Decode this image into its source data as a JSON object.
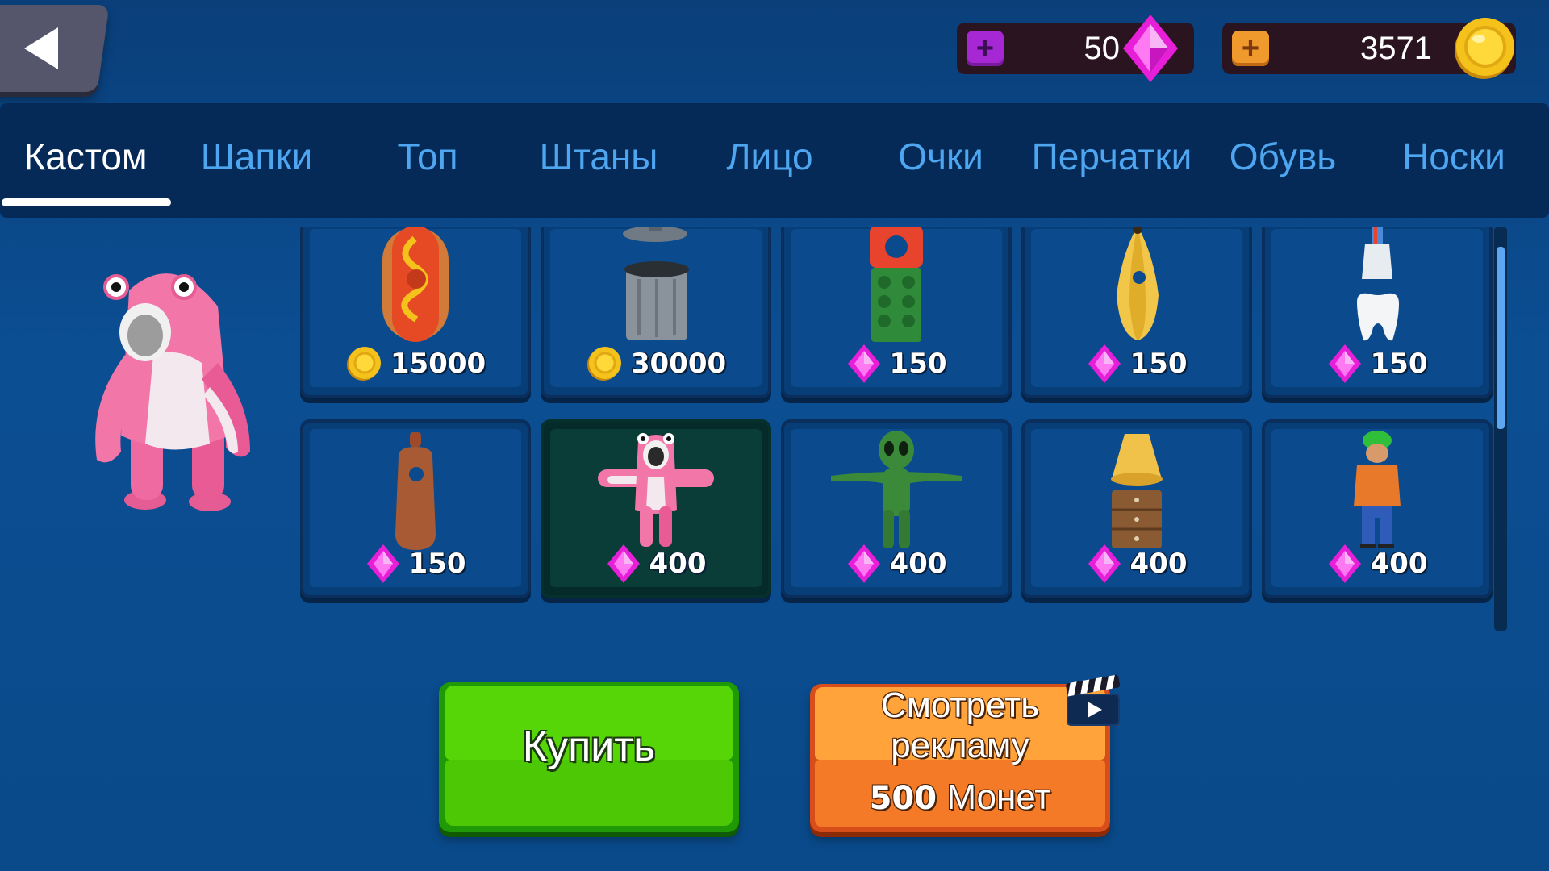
{
  "colors": {
    "background": "#0b4d8c",
    "tab_active": "#ffffff",
    "tab_inactive": "#4ea6f0",
    "buy_button": "#4cc904",
    "ad_button": "#f47a28",
    "gem": "#e81fd9",
    "coin": "#f5c21c"
  },
  "currency": {
    "gems": {
      "value": "50",
      "icon": "gem-icon",
      "add_icon": "plus-icon"
    },
    "coins": {
      "value": "3571",
      "icon": "coin-icon",
      "add_icon": "plus-icon"
    }
  },
  "tabs": [
    {
      "label": "Кастом",
      "active": true
    },
    {
      "label": "Шапки",
      "active": false
    },
    {
      "label": "Топ",
      "active": false
    },
    {
      "label": "Штаны",
      "active": false
    },
    {
      "label": "Лицо",
      "active": false
    },
    {
      "label": "Очки",
      "active": false
    },
    {
      "label": "Перчатки",
      "active": false
    },
    {
      "label": "Обувь",
      "active": false
    },
    {
      "label": "Носки",
      "active": false
    }
  ],
  "items": [
    {
      "art": "hotdog-costume-icon",
      "currency": "coin",
      "price": "15000"
    },
    {
      "art": "trash-can-costume-icon",
      "currency": "coin",
      "price": "30000"
    },
    {
      "art": "building-block-costume-icon",
      "currency": "gem",
      "price": "150"
    },
    {
      "art": "banana-costume-icon",
      "currency": "gem",
      "price": "150"
    },
    {
      "art": "tooth-costume-icon",
      "currency": "gem",
      "price": "150"
    },
    {
      "art": "sausage-costume-icon",
      "currency": "gem",
      "price": "150"
    },
    {
      "art": "pink-shark-costume-icon",
      "currency": "gem",
      "price": "400",
      "selected": true
    },
    {
      "art": "green-alien-costume-icon",
      "currency": "gem",
      "price": "400"
    },
    {
      "art": "lamp-cabinet-costume-icon",
      "currency": "gem",
      "price": "400"
    },
    {
      "art": "green-cap-guy-costume-icon",
      "currency": "gem",
      "price": "400"
    }
  ],
  "buttons": {
    "buy": "Купить",
    "watch_ad_line1": "Смотреть",
    "watch_ad_line2": "рекламу",
    "watch_ad_amount": "500",
    "watch_ad_unit": "Монет"
  }
}
